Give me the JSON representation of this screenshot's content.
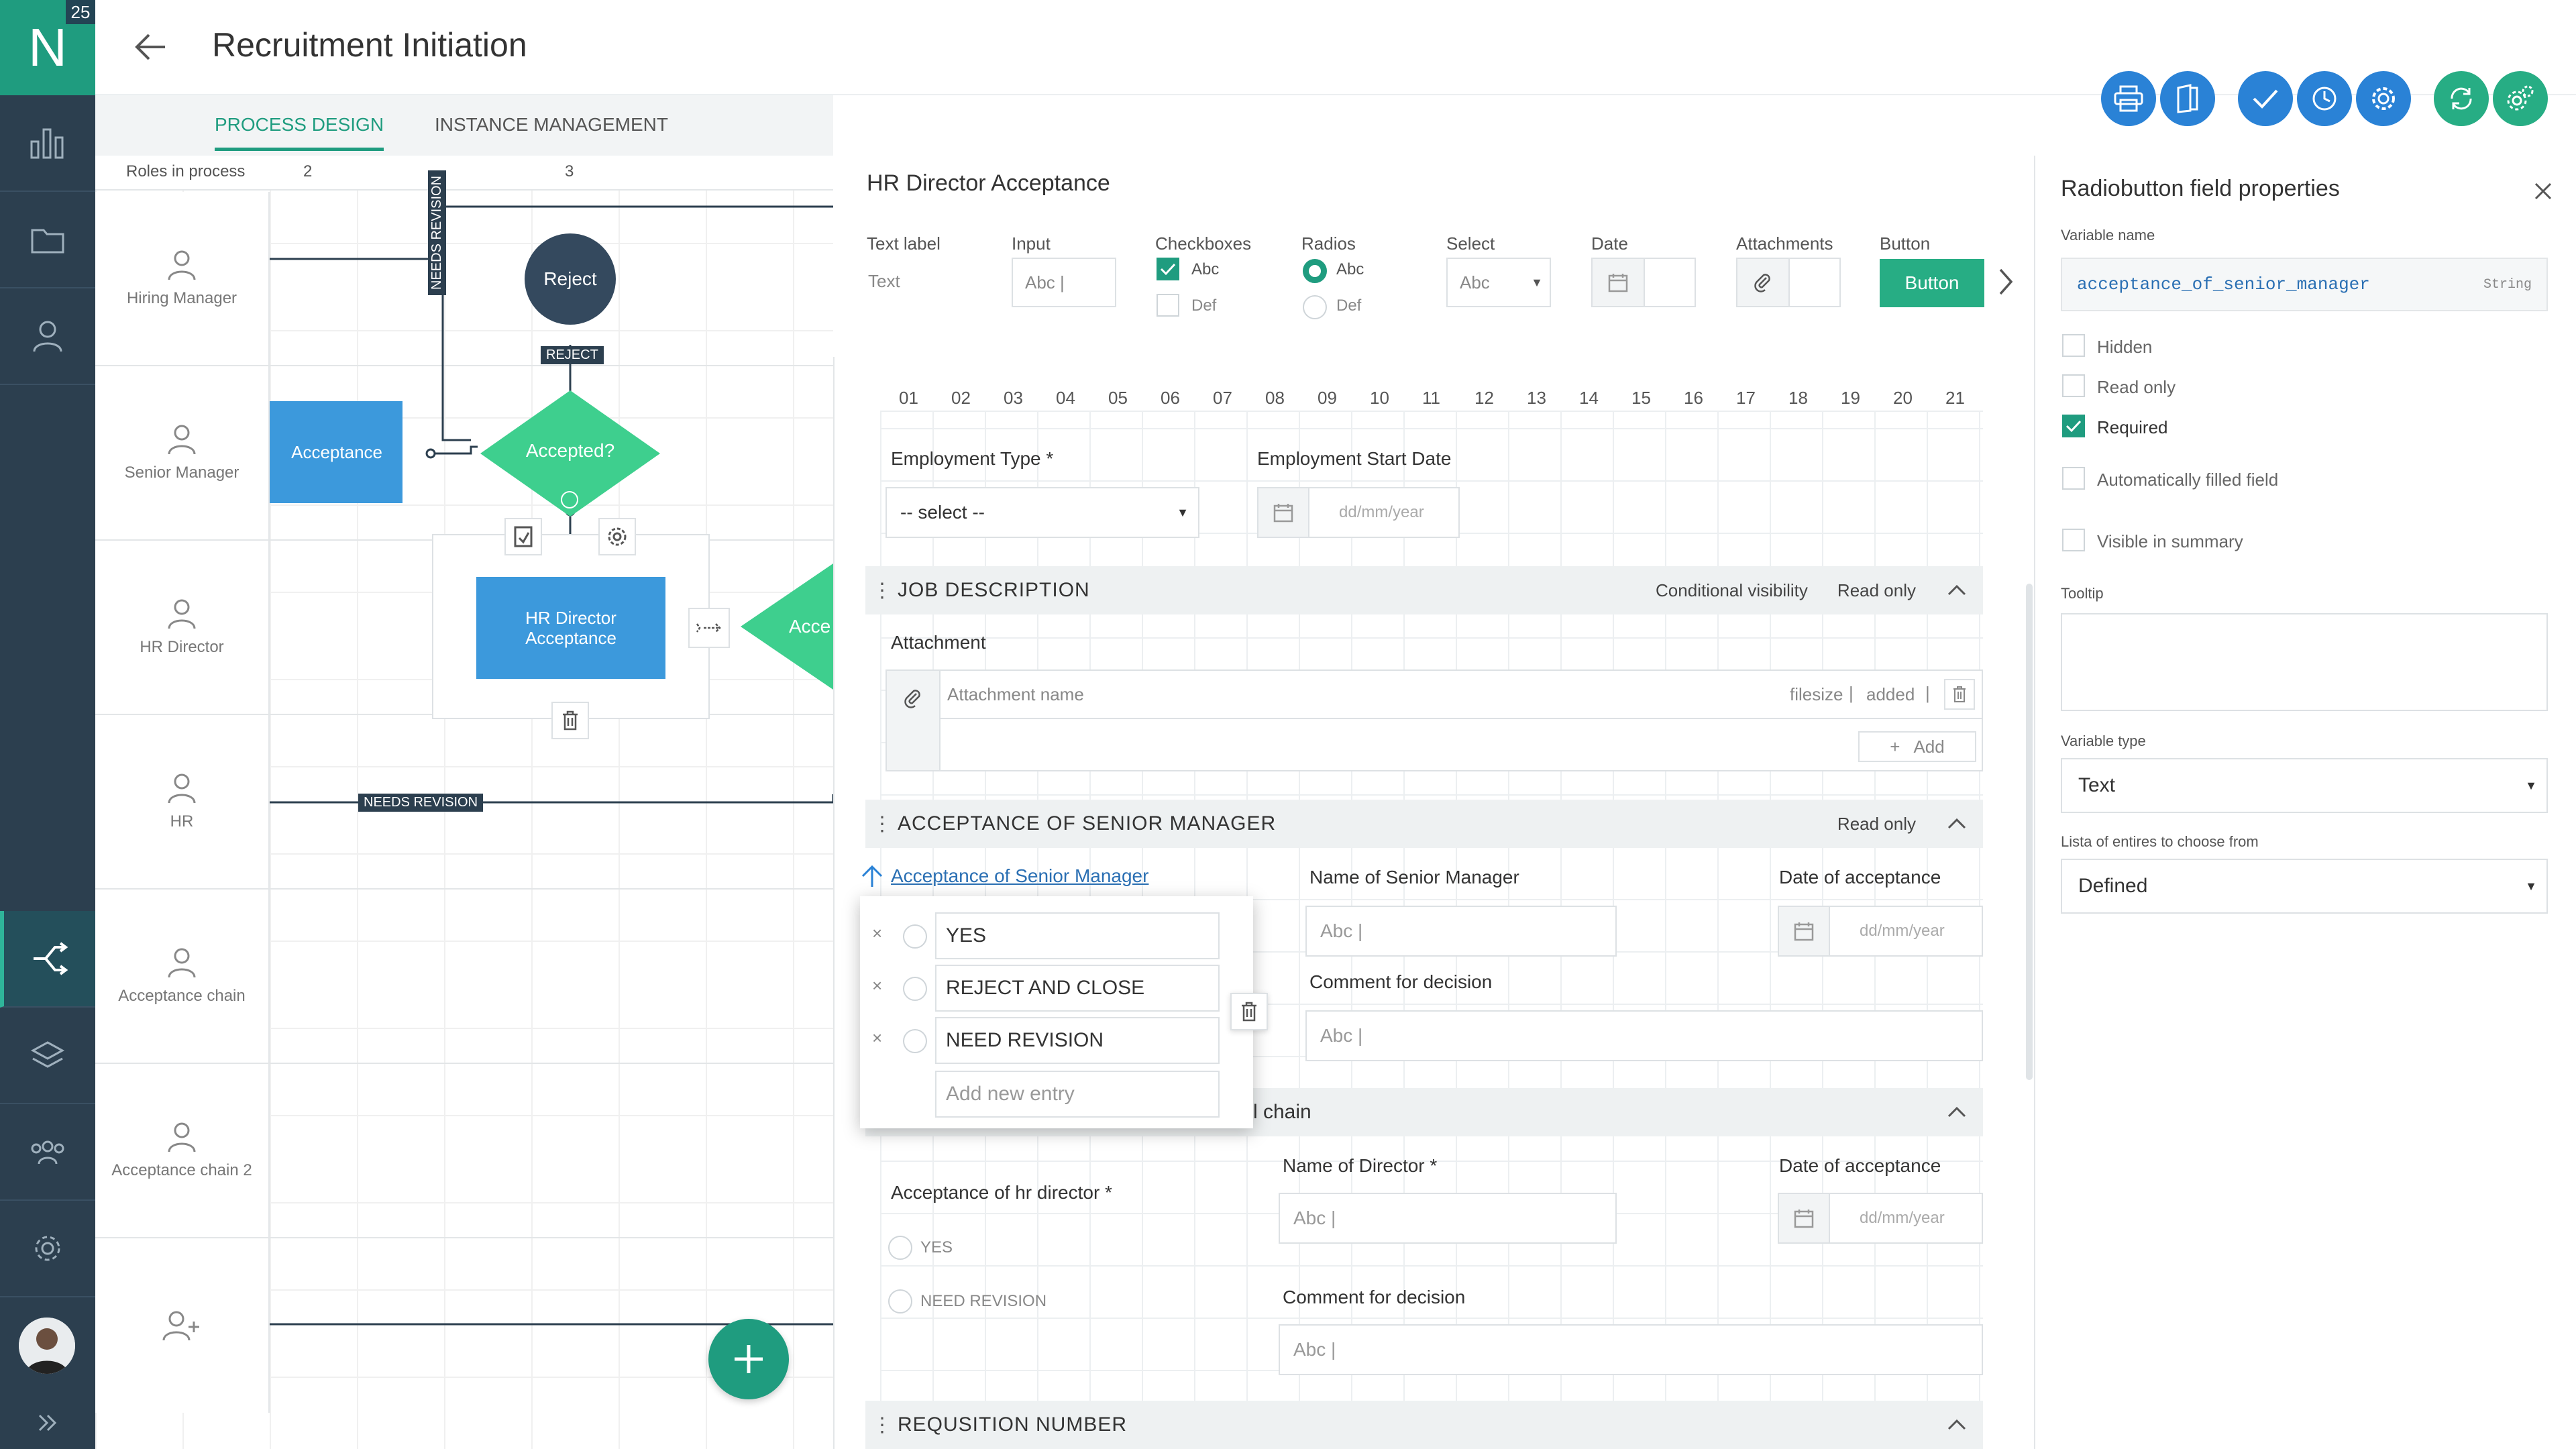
{
  "app": {
    "logo_letter": "N",
    "badge": "25"
  },
  "header": {
    "title": "Recruitment Initiation"
  },
  "tabs": [
    {
      "label": "PROCESS DESIGN"
    },
    {
      "label": "INSTANCE MANAGEMENT"
    }
  ],
  "canvas": {
    "roles_header": "Roles in process",
    "columns": [
      "2",
      "3"
    ],
    "lanes": [
      "Hiring Manager",
      "Senior Manager",
      "HR Director",
      "HR",
      "Acceptance chain",
      "Acceptance chain 2"
    ],
    "nodes": {
      "reject": "Reject",
      "reject_tag": "REJECT",
      "needs_revision_vertical": "NEEDS REVISION",
      "acceptance": "Acceptance",
      "accepted": "Accepted?",
      "hr_director_acceptance_line1": "HR Director",
      "hr_director_acceptance_line2": "Acceptance",
      "accept_partial": "Acce",
      "needs_revision_tag": "NEEDS REVISION"
    }
  },
  "builder": {
    "title": "HR Director Acceptance",
    "palette": {
      "text_label": {
        "label": "Text label",
        "value": "Text"
      },
      "input": {
        "label": "Input",
        "value": "Abc |"
      },
      "checkboxes": {
        "label": "Checkboxes",
        "a": "Abc",
        "b": "Def"
      },
      "radios": {
        "label": "Radios",
        "a": "Abc",
        "b": "Def"
      },
      "select": {
        "label": "Select",
        "value": "Abc"
      },
      "date": {
        "label": "Date"
      },
      "attachments": {
        "label": "Attachments"
      },
      "button": {
        "label": "Button",
        "value": "Button"
      }
    },
    "column_numbers": [
      "01",
      "02",
      "03",
      "04",
      "05",
      "06",
      "07",
      "08",
      "09",
      "10",
      "11",
      "12",
      "13",
      "14",
      "15",
      "16",
      "17",
      "18",
      "19",
      "20",
      "21"
    ],
    "employment_type": {
      "label": "Employment Type *",
      "value": "-- select --"
    },
    "employment_start": {
      "label": "Employment Start Date",
      "placeholder": "dd/mm/year"
    },
    "job_description": {
      "title": "JOB DESCRIPTION",
      "cond": "Conditional visibility",
      "readonly": "Read only",
      "attachment_label": "Attachment",
      "attachment_name": "Attachment name",
      "filesize": "filesize",
      "added": "added",
      "add": "Add"
    },
    "acceptance_senior": {
      "title": "ACCEPTANCE OF SENIOR MANAGER",
      "readonly": "Read only",
      "field_label": "Acceptance of Senior Manager",
      "name_label": "Name of Senior Manager",
      "name_placeholder": "Abc |",
      "date_label": "Date of acceptance",
      "date_placeholder": "dd/mm/year",
      "comment_label": "Comment for decision",
      "comment_placeholder": "Abc |"
    },
    "popup": {
      "options": [
        "YES",
        "REJECT AND CLOSE",
        "NEED REVISION"
      ],
      "add_new": "Add new entry"
    },
    "chain_section": {
      "title_partial": "l chain",
      "accept_label": "Acceptance of hr director *",
      "opt_yes": "YES",
      "opt_revision": "NEED REVISION",
      "director_label": "Name of Director *",
      "director_placeholder": "Abc |",
      "date_label": "Date of acceptance",
      "date_placeholder": "dd/mm/year",
      "comment_label": "Comment for decision",
      "comment_placeholder": "Abc |"
    },
    "requisition": {
      "title": "REQUSITION NUMBER"
    }
  },
  "props": {
    "title": "Radiobutton field properties",
    "variable_name_label": "Variable name",
    "variable_name": "acceptance_of_senior_manager",
    "variable_kind": "String",
    "checks": [
      {
        "label": "Hidden",
        "on": false
      },
      {
        "label": "Read only",
        "on": false
      },
      {
        "label": "Required",
        "on": true
      },
      {
        "label": "Automatically filled field",
        "on": false
      },
      {
        "label": "Visible in summary",
        "on": false
      }
    ],
    "tooltip_label": "Tooltip",
    "variable_type_label": "Variable type",
    "variable_type": "Text",
    "entries_label": "Lista of entires to choose from",
    "entries_value": "Defined"
  },
  "colors": {
    "nav": "#2c3f4f",
    "accent_green": "#1f9c7f",
    "accent_blue": "#2a82d6",
    "node_blue": "#3c99dc",
    "diamond_green": "#3ecf8e"
  }
}
